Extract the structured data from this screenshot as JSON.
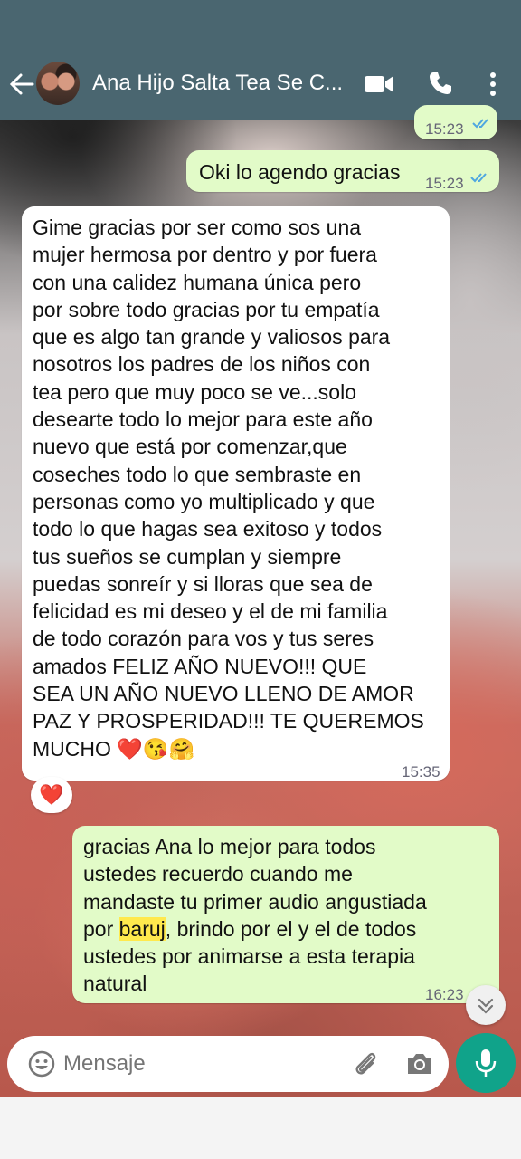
{
  "header": {
    "title": "Ana Hijo Salta Tea Se C..."
  },
  "messages": [
    {
      "direction": "outgoing",
      "time": "15:23",
      "status": "read"
    },
    {
      "direction": "outgoing",
      "text": "Oki lo agendo gracias",
      "time": "15:23",
      "status": "read"
    },
    {
      "direction": "incoming",
      "lines": [
        "Gime gracias por ser como sos una",
        "mujer hermosa por dentro y por fuera",
        "con una calidez humana única pero",
        "por sobre todo gracias por tu empatía",
        "que es algo tan grande y valiosos para",
        "nosotros los padres de los niños con",
        "tea pero que muy poco se ve...solo",
        "desearte todo lo mejor para este año",
        "nuevo que está por comenzar,que",
        "coseches todo lo que sembraste en",
        "personas como yo multiplicado y que",
        "todo lo que hagas sea exitoso y todos",
        "tus sueños se cumplan y siempre",
        "puedas sonreír y si lloras que sea de",
        "felicidad es mi deseo y el  de mi familia",
        "de todo corazón para vos y tus seres",
        "amados FELIZ AÑO NUEVO!!! QUE",
        "SEA UN AÑO NUEVO LLENO DE AMOR",
        "PAZ Y PROSPERIDAD!!! TE QUEREMOS",
        "MUCHO ❤️😘🤗"
      ],
      "time": "15:35",
      "reaction": "❤️"
    },
    {
      "direction": "outgoing",
      "line1": "gracias Ana lo mejor para todos",
      "line2": "ustedes recuerdo cuando me",
      "line3": "mandaste tu primer audio angustiada",
      "line4_before": "por ",
      "line4_highlight": "baruj",
      "line4_after": ", brindo por el y el de todos",
      "line5": "ustedes por animarse a esta terapia",
      "line6": "natural",
      "time": "16:23",
      "status": "delivered"
    }
  ],
  "composer": {
    "placeholder": "Mensaje"
  },
  "icons": {
    "back": "back-arrow-icon",
    "video": "video-call-icon",
    "call": "phone-icon",
    "menu": "more-vert-icon",
    "emoji": "emoji-icon",
    "attach": "paperclip-icon",
    "camera": "camera-icon",
    "mic": "mic-icon",
    "scroll": "chevron-double-down-icon"
  },
  "colors": {
    "header": "#4a6670",
    "outgoing_bubble": "#e2fbc8",
    "incoming_bubble": "#ffffff",
    "read_ticks": "#4fa7e0",
    "mic_button": "#10a38a"
  }
}
